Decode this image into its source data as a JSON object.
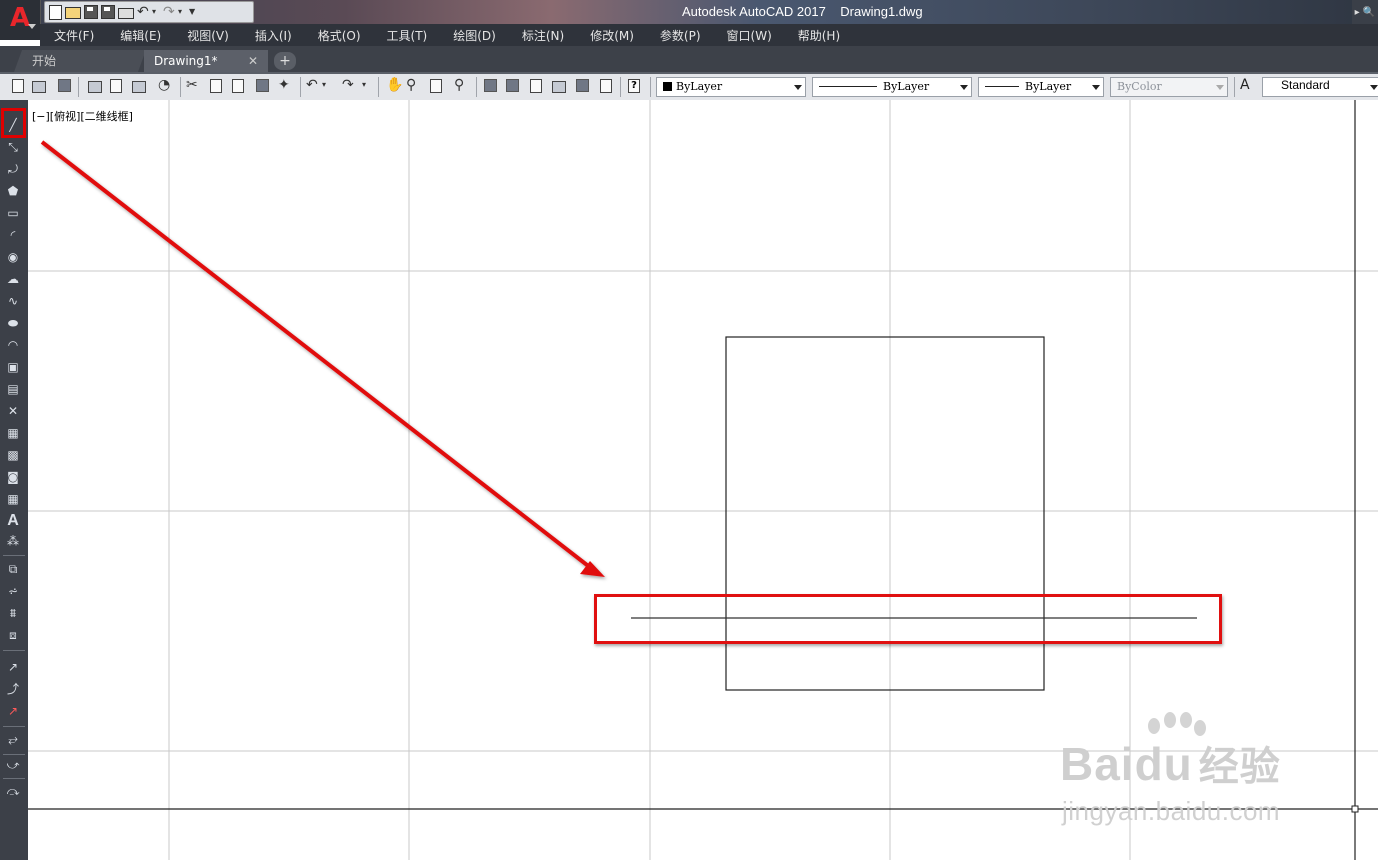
{
  "window": {
    "title": "Autodesk AutoCAD 2017    Drawing1.dwg",
    "logo_letter": "A",
    "right_glyph": "▸ 🔍"
  },
  "menu": [
    "文件(F)",
    "编辑(E)",
    "视图(V)",
    "插入(I)",
    "格式(O)",
    "工具(T)",
    "绘图(D)",
    "标注(N)",
    "修改(M)",
    "参数(P)",
    "窗口(W)",
    "帮助(H)"
  ],
  "tabs": {
    "start": "开始",
    "drawing": "Drawing1*",
    "close_glyph": "✕",
    "add_glyph": "+"
  },
  "toolbar": {
    "color_value": "ByLayer",
    "linetype_value": "ByLayer",
    "lineweight_value": "ByLayer",
    "plotstyle_value": "ByColor",
    "textstyle_value": "Standard",
    "help_glyph": "?"
  },
  "viewport": {
    "label": "[−][俯视][二维线框]"
  },
  "watermark": {
    "brand": "Baidu",
    "cn": "经验",
    "url": "jingyan.baidu.com"
  },
  "colors": {
    "annotation_red": "#e01010",
    "canvas_bg": "#ffffff",
    "grid": "#c8c8c8"
  }
}
